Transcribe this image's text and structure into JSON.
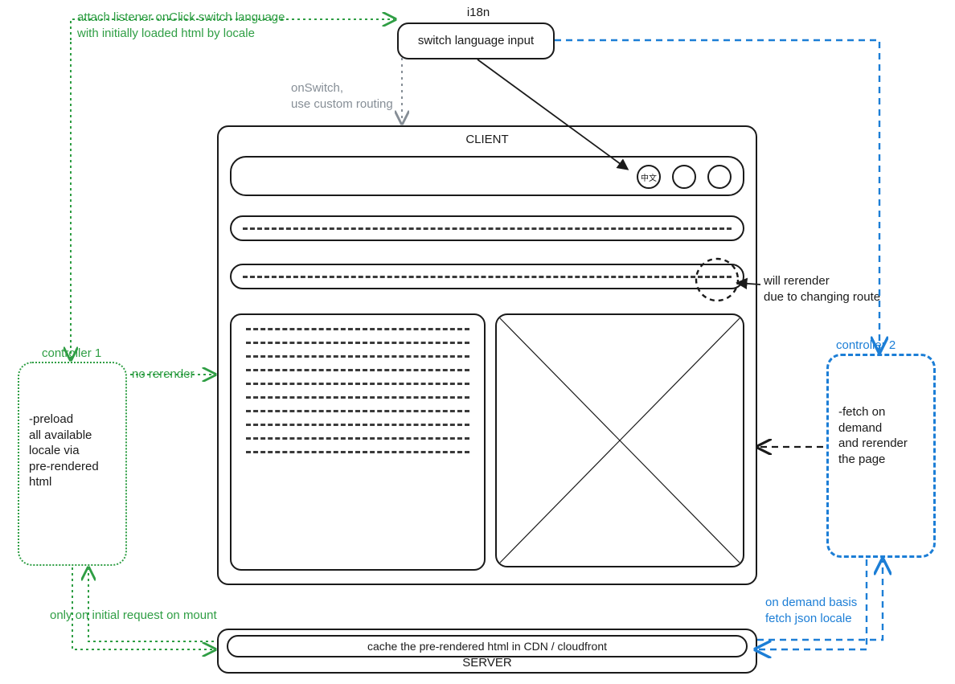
{
  "i18n": {
    "title": "i18n",
    "switch_input": "switch language input"
  },
  "annotations": {
    "attach_listener": "attach listener onClick switch language\nwith initially loaded html by locale",
    "on_switch": "onSwitch,\nuse custom routing",
    "will_rerender": "will rerender\ndue to changing route",
    "no_rerender": "no rerender",
    "only_initial": "only on initial request on mount",
    "on_demand": "on demand basis\nfetch json locale"
  },
  "client": {
    "title": "CLIENT",
    "lang_btn": "中文"
  },
  "controller1": {
    "title": "controller 1",
    "body": "-preload\nall available\nlocale via\npre-rendered html"
  },
  "controller2": {
    "title": "controller 2",
    "body": "-fetch on demand\nand rerender\nthe page"
  },
  "server": {
    "cache_label": "cache the pre-rendered html in CDN / cloudfront",
    "title": "SERVER"
  }
}
